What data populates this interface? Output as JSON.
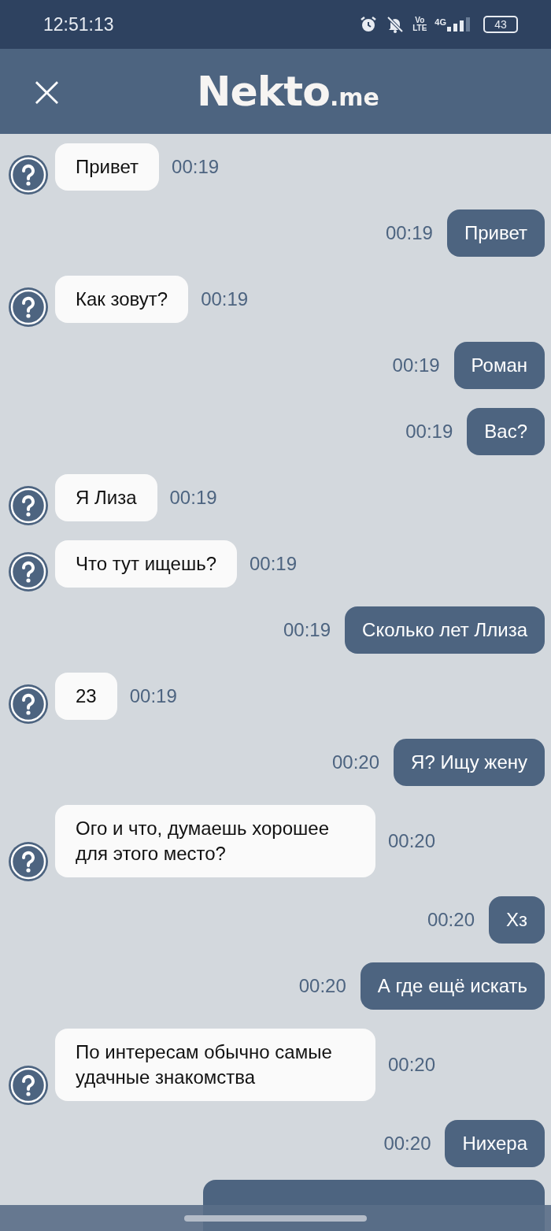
{
  "status_bar": {
    "time": "12:51:13",
    "volte_top": "Vo",
    "volte_bottom": "LTE",
    "network": "4G",
    "battery": "43"
  },
  "header": {
    "close": "×",
    "logo_main": "Nekto",
    "logo_suffix": ".me"
  },
  "messages": [
    {
      "kind": "received",
      "text": "Привет",
      "time": "00:19"
    },
    {
      "kind": "sent",
      "text": "Привет",
      "time": "00:19"
    },
    {
      "kind": "received",
      "text": "Как зовут?",
      "time": "00:19"
    },
    {
      "kind": "sent",
      "text": "Роман",
      "time": "00:19"
    },
    {
      "kind": "sent",
      "text": "Вас?",
      "time": "00:19"
    },
    {
      "kind": "received",
      "text": "Я Лиза",
      "time": "00:19"
    },
    {
      "kind": "received",
      "text": "Что тут ищешь?",
      "time": "00:19"
    },
    {
      "kind": "sent",
      "text": "Сколько лет Ллиза",
      "time": "00:19"
    },
    {
      "kind": "received",
      "text": "23",
      "time": "00:19"
    },
    {
      "kind": "sent",
      "text": "Я? Ищу жену",
      "time": "00:20"
    },
    {
      "kind": "received",
      "text": "Ого и что, думаешь хорошее для этого место?",
      "time": "00:20"
    },
    {
      "kind": "sent",
      "text": "Хз",
      "time": "00:20"
    },
    {
      "kind": "sent",
      "text": "А где ещё искать",
      "time": "00:20"
    },
    {
      "kind": "received",
      "text": "По интересам обычно самые удачные знакомства",
      "time": "00:20"
    },
    {
      "kind": "sent",
      "text": "Нихера",
      "time": "00:20"
    },
    {
      "kind": "sent-partial"
    }
  ]
}
